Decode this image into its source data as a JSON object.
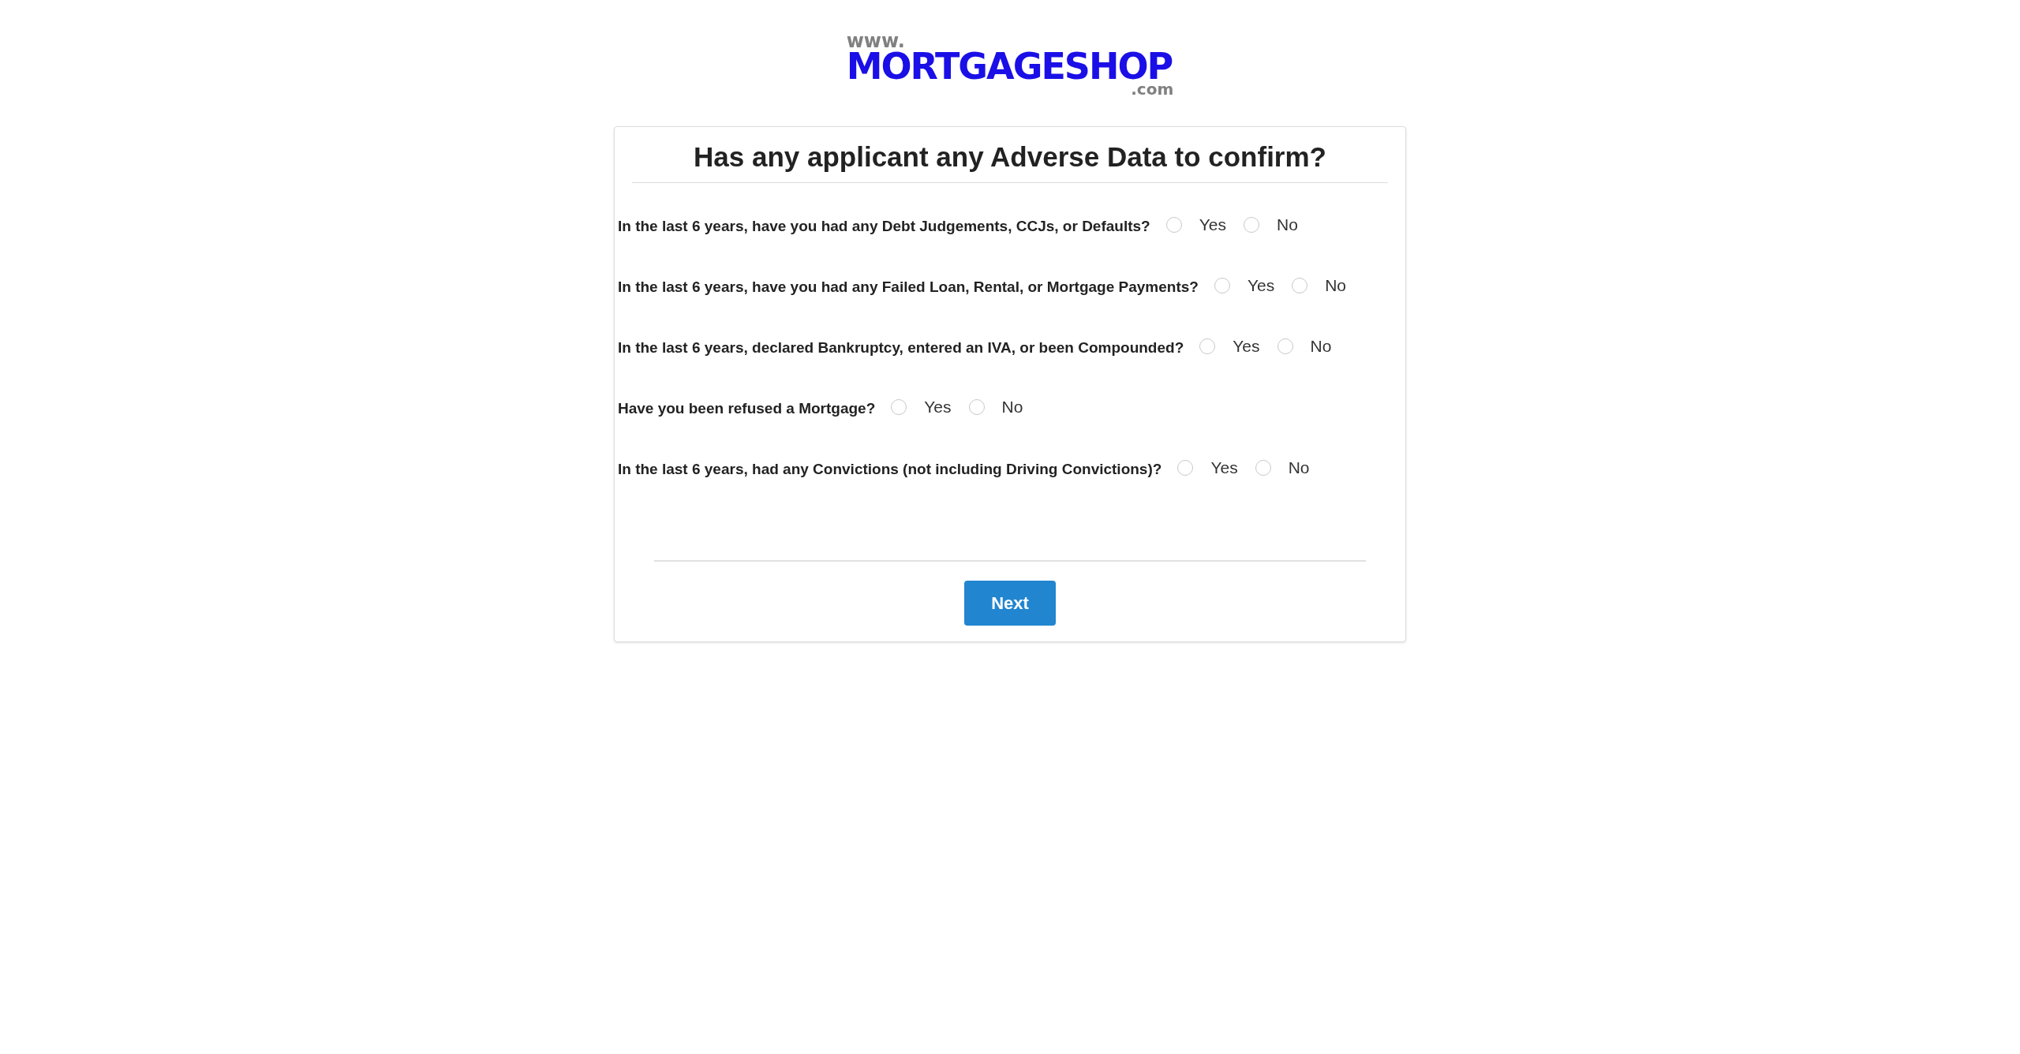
{
  "logo": {
    "prefix": "www.",
    "name": "MORTGAGESHOP",
    "suffix": ".com"
  },
  "title": "Has any applicant any Adverse Data to confirm?",
  "questions": [
    {
      "label": "In the last 6 years, have you had any Debt Judgements, CCJs, or Defaults?",
      "options": [
        {
          "label": "Yes",
          "selected": false
        },
        {
          "label": "No",
          "selected": false
        }
      ]
    },
    {
      "label": "In the last 6 years, have you had any Failed Loan, Rental, or Mortgage Payments?",
      "options": [
        {
          "label": "Yes",
          "selected": false
        },
        {
          "label": "No",
          "selected": false
        }
      ]
    },
    {
      "label": "In the last 6 years, declared Bankruptcy, entered an IVA, or been Compounded?",
      "options": [
        {
          "label": "Yes",
          "selected": false
        },
        {
          "label": "No",
          "selected": false
        }
      ]
    },
    {
      "label": "Have you been refused a Mortgage?",
      "options": [
        {
          "label": "Yes",
          "selected": false
        },
        {
          "label": "No",
          "selected": false
        }
      ]
    },
    {
      "label": "In the last 6 years, had any Convictions (not including Driving Convictions)?",
      "options": [
        {
          "label": "Yes",
          "selected": false
        },
        {
          "label": "No",
          "selected": false
        }
      ]
    }
  ],
  "next_button": "Next"
}
